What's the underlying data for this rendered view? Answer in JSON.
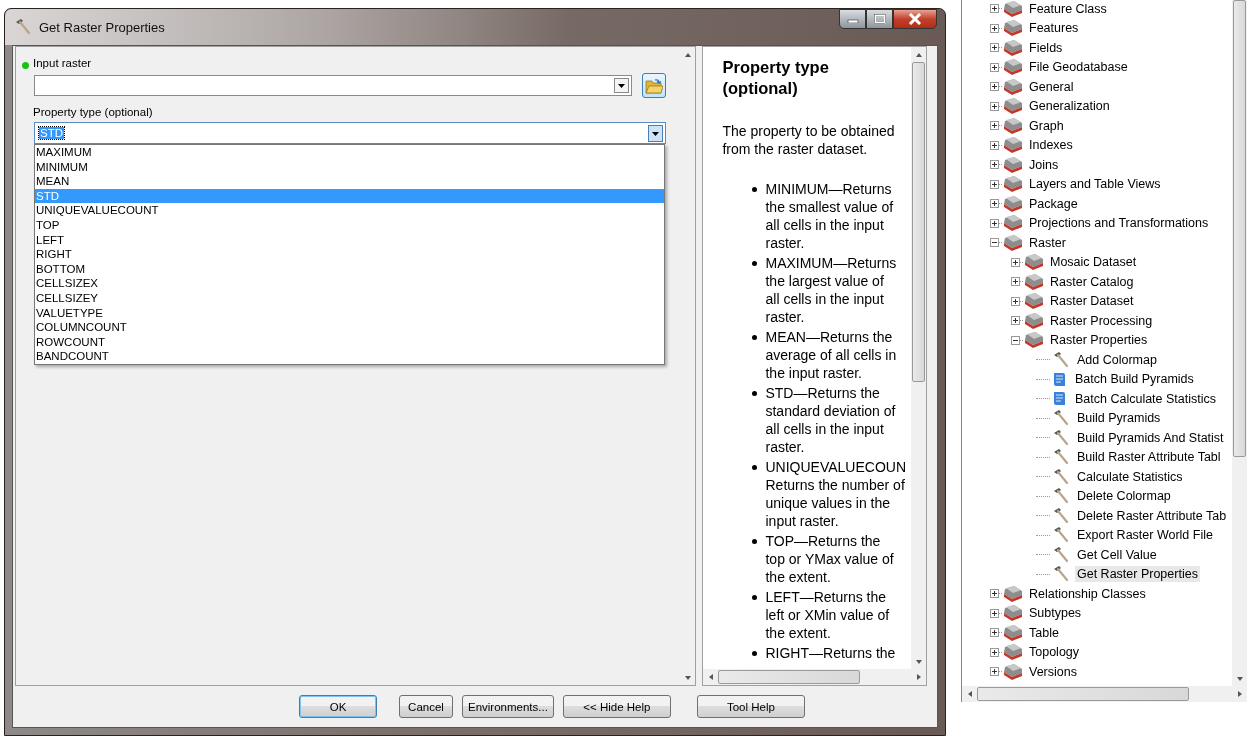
{
  "window": {
    "title": "Get Raster Properties"
  },
  "input_raster": {
    "label": "Input raster",
    "required": true
  },
  "property_type": {
    "label": "Property type (optional)",
    "value": "STD",
    "expanded": true,
    "options": [
      {
        "label": "MAXIMUM",
        "selected": false
      },
      {
        "label": "MINIMUM",
        "selected": false
      },
      {
        "label": "MEAN",
        "selected": false
      },
      {
        "label": "STD",
        "selected": true
      },
      {
        "label": "UNIQUEVALUECOUNT",
        "selected": false
      },
      {
        "label": "TOP",
        "selected": false
      },
      {
        "label": "LEFT",
        "selected": false
      },
      {
        "label": "RIGHT",
        "selected": false
      },
      {
        "label": "BOTTOM",
        "selected": false
      },
      {
        "label": "CELLSIZEX",
        "selected": false
      },
      {
        "label": "CELLSIZEY",
        "selected": false
      },
      {
        "label": "VALUETYPE",
        "selected": false
      },
      {
        "label": "COLUMNCOUNT",
        "selected": false
      },
      {
        "label": "ROWCOUNT",
        "selected": false
      },
      {
        "label": "BANDCOUNT",
        "selected": false
      }
    ]
  },
  "help": {
    "heading": "Property type (optional)",
    "intro": "The property to be obtained from the raster dataset.",
    "bullets": [
      "MINIMUM—Returns the smallest value of all cells in the input raster.",
      "MAXIMUM—Returns the largest value of all cells in the input raster.",
      "MEAN—Returns the average of all cells in the input raster.",
      "STD—Returns the standard deviation of all cells in the input raster.",
      "UNIQUEVALUECOUN Returns the number of unique values in the input raster.",
      "TOP—Returns the top or YMax value of the extent.",
      "LEFT—Returns the left or XMin value of the extent.",
      "RIGHT—Returns the"
    ]
  },
  "buttons": [
    {
      "label": "OK",
      "default": true
    },
    {
      "label": "Cancel",
      "default": false
    },
    {
      "label": "Environments...",
      "default": false
    },
    {
      "label": "<< Hide Help",
      "default": false
    },
    {
      "label": "Tool Help",
      "default": false,
      "kind": "help"
    }
  ],
  "tree": {
    "items": [
      {
        "label": "Feature Class",
        "kind": "toolset",
        "expanded": false,
        "selected": false
      },
      {
        "label": "Features",
        "kind": "toolset",
        "expanded": false,
        "selected": false
      },
      {
        "label": "Fields",
        "kind": "toolset",
        "expanded": false,
        "selected": false
      },
      {
        "label": "File Geodatabase",
        "kind": "toolset",
        "expanded": false,
        "selected": false
      },
      {
        "label": "General",
        "kind": "toolset",
        "expanded": false,
        "selected": false
      },
      {
        "label": "Generalization",
        "kind": "toolset",
        "expanded": false,
        "selected": false
      },
      {
        "label": "Graph",
        "kind": "toolset",
        "expanded": false,
        "selected": false
      },
      {
        "label": "Indexes",
        "kind": "toolset",
        "expanded": false,
        "selected": false
      },
      {
        "label": "Joins",
        "kind": "toolset",
        "expanded": false,
        "selected": false
      },
      {
        "label": "Layers and Table Views",
        "kind": "toolset",
        "expanded": false,
        "selected": false
      },
      {
        "label": "Package",
        "kind": "toolset",
        "expanded": false,
        "selected": false
      },
      {
        "label": "Projections and Transformations",
        "kind": "toolset",
        "expanded": false,
        "selected": false
      },
      {
        "label": "Raster",
        "kind": "toolset",
        "expanded": true,
        "selected": false,
        "children": [
          {
            "label": "Mosaic Dataset",
            "kind": "toolset",
            "expanded": false,
            "selected": false
          },
          {
            "label": "Raster Catalog",
            "kind": "toolset",
            "expanded": false,
            "selected": false
          },
          {
            "label": "Raster Dataset",
            "kind": "toolset",
            "expanded": false,
            "selected": false
          },
          {
            "label": "Raster Processing",
            "kind": "toolset",
            "expanded": false,
            "selected": false
          },
          {
            "label": "Raster Properties",
            "kind": "toolset",
            "expanded": true,
            "selected": false,
            "children": [
              {
                "label": "Add Colormap",
                "kind": "tool",
                "selected": false
              },
              {
                "label": "Batch Build Pyramids",
                "kind": "batch",
                "selected": false
              },
              {
                "label": "Batch Calculate Statistics",
                "kind": "batch",
                "selected": false
              },
              {
                "label": "Build Pyramids",
                "kind": "tool",
                "selected": false
              },
              {
                "label": "Build Pyramids And Statist",
                "kind": "tool",
                "selected": false
              },
              {
                "label": "Build Raster Attribute Tabl",
                "kind": "tool",
                "selected": false
              },
              {
                "label": "Calculate Statistics",
                "kind": "tool",
                "selected": false
              },
              {
                "label": "Delete Colormap",
                "kind": "tool",
                "selected": false
              },
              {
                "label": "Delete Raster Attribute Tab",
                "kind": "tool",
                "selected": false
              },
              {
                "label": "Export Raster World File",
                "kind": "tool",
                "selected": false
              },
              {
                "label": "Get Cell Value",
                "kind": "tool",
                "selected": false
              },
              {
                "label": "Get Raster Properties",
                "kind": "tool",
                "selected": true
              }
            ]
          }
        ]
      },
      {
        "label": "Relationship Classes",
        "kind": "toolset",
        "expanded": false,
        "selected": false
      },
      {
        "label": "Subtypes",
        "kind": "toolset",
        "expanded": false,
        "selected": false
      },
      {
        "label": "Table",
        "kind": "toolset",
        "expanded": false,
        "selected": false
      },
      {
        "label": "Topology",
        "kind": "toolset",
        "expanded": false,
        "selected": false
      },
      {
        "label": "Versions",
        "kind": "toolset",
        "expanded": false,
        "selected": false
      }
    ]
  }
}
